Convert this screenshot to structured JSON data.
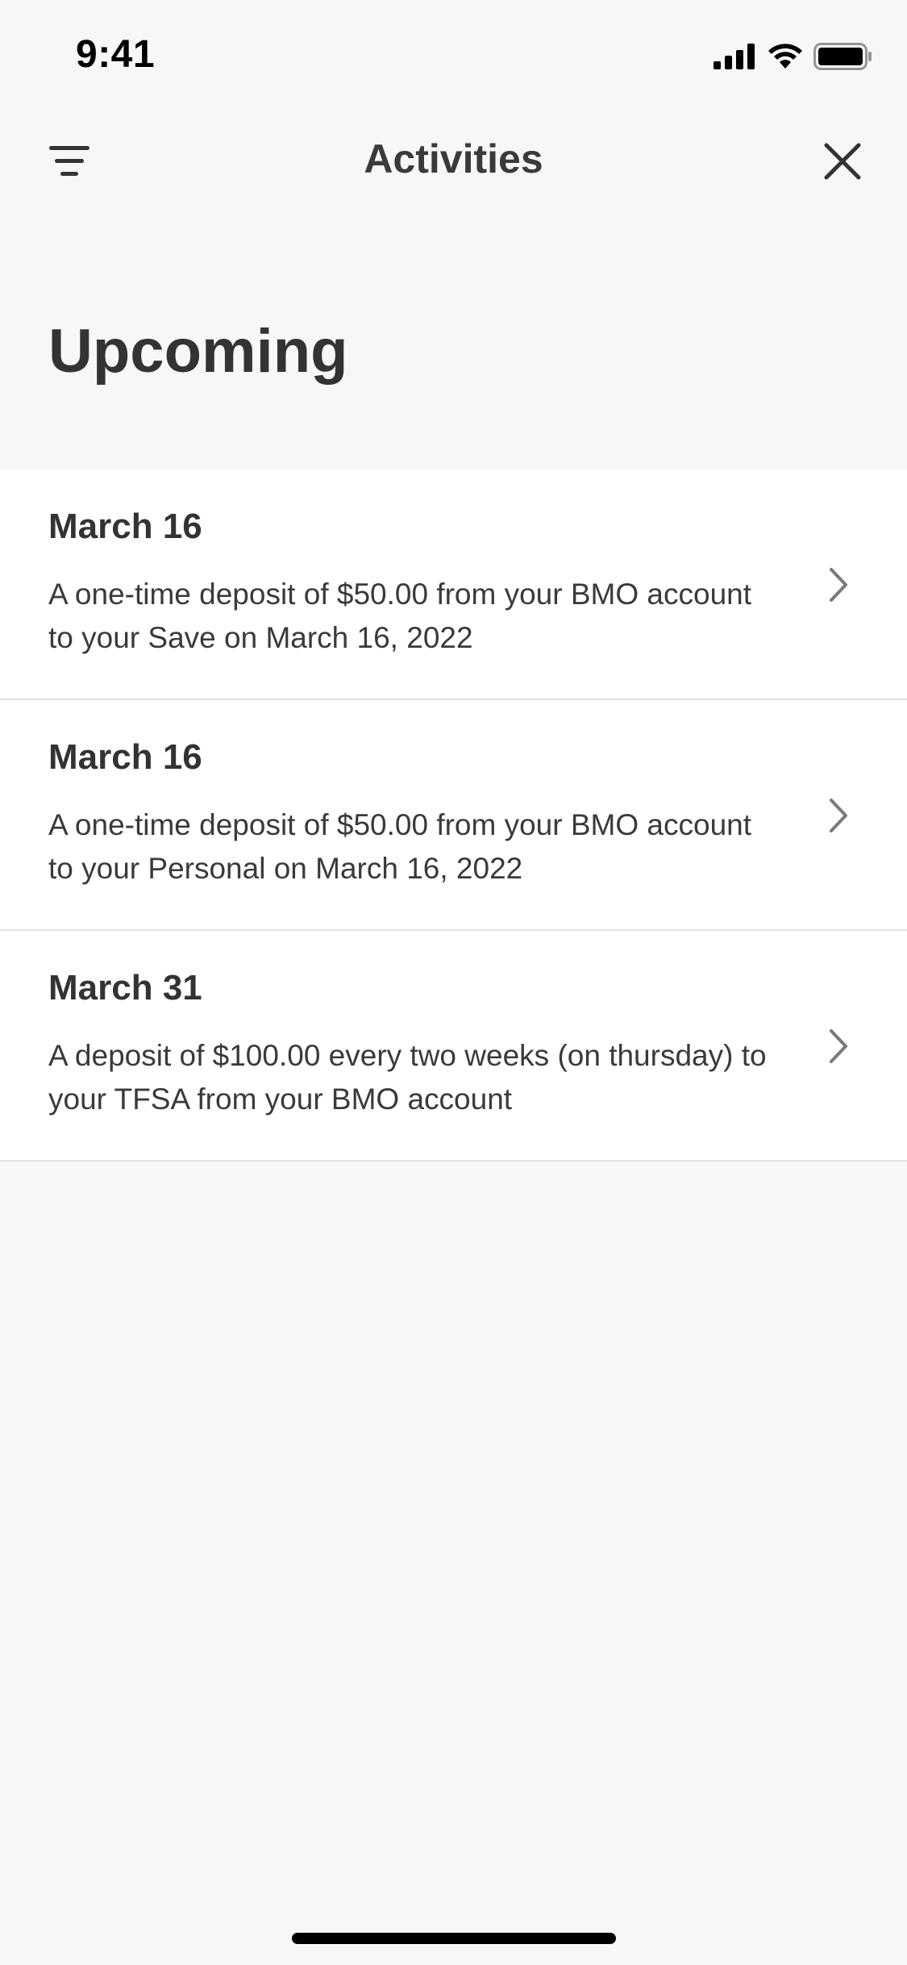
{
  "status_bar": {
    "time": "9:41"
  },
  "nav": {
    "title": "Activities",
    "filter_icon": "filter-icon",
    "close_icon": "close-icon"
  },
  "section": {
    "title": "Upcoming"
  },
  "activities": [
    {
      "date": "March 16",
      "description": "A one-time deposit of $50.00 from your BMO account to your Save on March 16, 2022"
    },
    {
      "date": "March 16",
      "description": "A one-time deposit of $50.00 from your BMO account to your Personal on March 16, 2022"
    },
    {
      "date": "March 31",
      "description": "A deposit of $100.00 every two weeks (on thursday) to your TFSA from your BMO account"
    }
  ],
  "colors": {
    "background": "#f8f7f5",
    "card": "#ffffff",
    "text": "#333333",
    "divider": "#e2e2e2",
    "chevron": "#7a7a7a"
  }
}
